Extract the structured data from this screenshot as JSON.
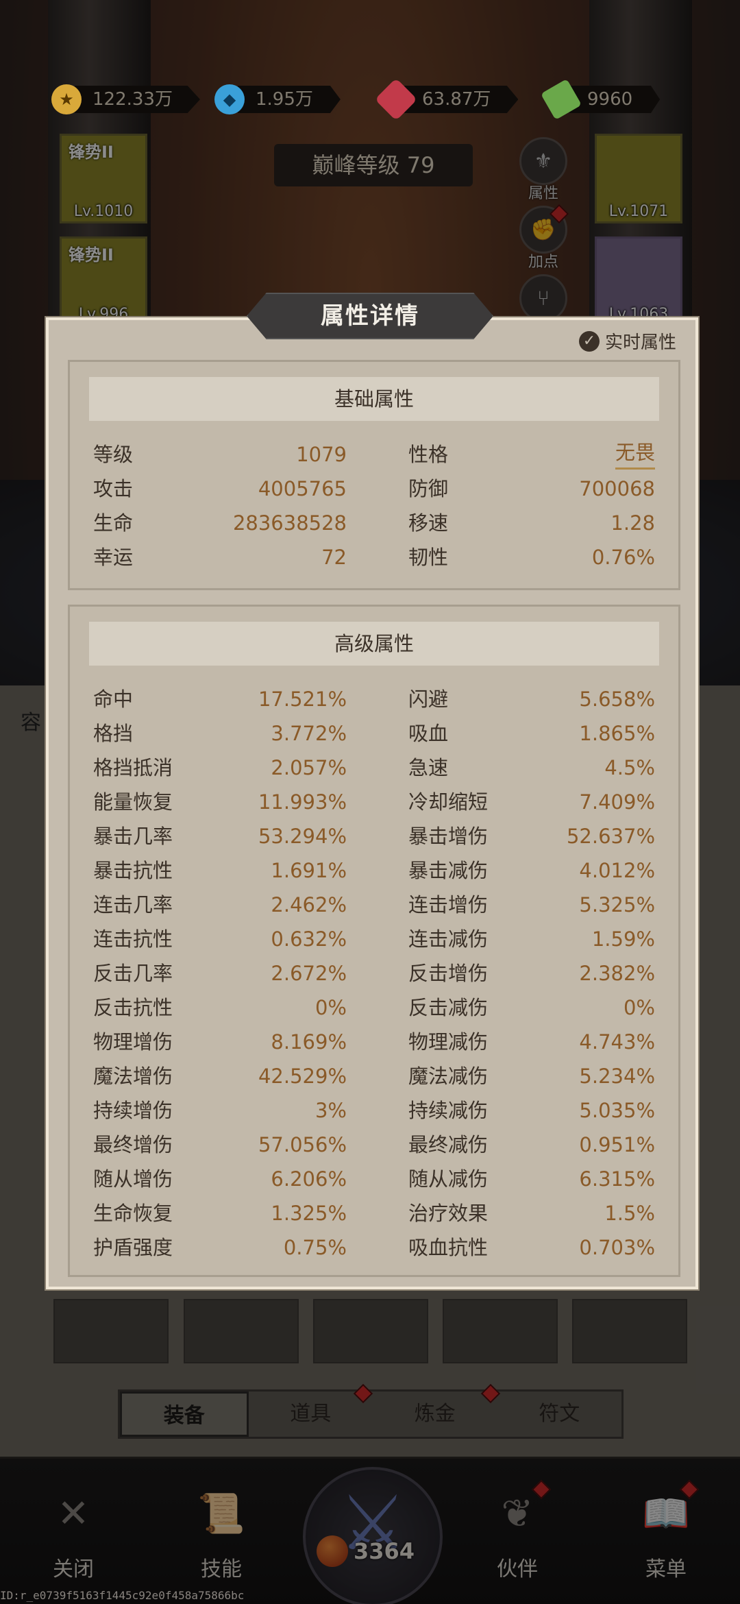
{
  "currencies": [
    {
      "name": "gold-coin-icon",
      "value": "122.33万"
    },
    {
      "name": "blue-gem-icon",
      "value": "1.95万"
    },
    {
      "name": "ruby-icon",
      "value": "63.87万"
    },
    {
      "name": "cash-icon",
      "value": "9960"
    }
  ],
  "peak_level": "巅峰等级 79",
  "cards": [
    {
      "name": "锋势II",
      "level": "Lv.1010"
    },
    {
      "name": "锋势II",
      "level": "Lv.996"
    },
    {
      "name": "",
      "level": "Lv.1071"
    },
    {
      "name": "",
      "level": "Lv.1063"
    }
  ],
  "side_buttons": {
    "attributes": "属性",
    "add_points": "加点"
  },
  "side_tab_partial": "容",
  "panel": {
    "title": "属性详情",
    "realtime_label": "实时属性",
    "basic": {
      "title": "基础属性",
      "rows": [
        [
          "等级",
          "1079",
          "性格",
          "无畏"
        ],
        [
          "攻击",
          "4005765",
          "防御",
          "700068"
        ],
        [
          "生命",
          "283638528",
          "移速",
          "1.28"
        ],
        [
          "幸运",
          "72",
          "韧性",
          "0.76%"
        ]
      ]
    },
    "advanced": {
      "title": "高级属性",
      "rows": [
        [
          "命中",
          "17.521%",
          "闪避",
          "5.658%"
        ],
        [
          "格挡",
          "3.772%",
          "吸血",
          "1.865%"
        ],
        [
          "格挡抵消",
          "2.057%",
          "急速",
          "4.5%"
        ],
        [
          "能量恢复",
          "11.993%",
          "冷却缩短",
          "7.409%"
        ],
        [
          "暴击几率",
          "53.294%",
          "暴击增伤",
          "52.637%"
        ],
        [
          "暴击抗性",
          "1.691%",
          "暴击减伤",
          "4.012%"
        ],
        [
          "连击几率",
          "2.462%",
          "连击增伤",
          "5.325%"
        ],
        [
          "连击抗性",
          "0.632%",
          "连击减伤",
          "1.59%"
        ],
        [
          "反击几率",
          "2.672%",
          "反击增伤",
          "2.382%"
        ],
        [
          "反击抗性",
          "0%",
          "反击减伤",
          "0%"
        ],
        [
          "物理增伤",
          "8.169%",
          "物理减伤",
          "4.743%"
        ],
        [
          "魔法增伤",
          "42.529%",
          "魔法减伤",
          "5.234%"
        ],
        [
          "持续增伤",
          "3%",
          "持续减伤",
          "5.035%"
        ],
        [
          "最终增伤",
          "57.056%",
          "最终减伤",
          "0.951%"
        ],
        [
          "随从增伤",
          "6.206%",
          "随从减伤",
          "6.315%"
        ],
        [
          "生命恢复",
          "1.325%",
          "治疗效果",
          "1.5%"
        ],
        [
          "护盾强度",
          "0.75%",
          "吸血抗性",
          "0.703%"
        ]
      ]
    }
  },
  "tabs": [
    "装备",
    "道具",
    "炼金",
    "符文"
  ],
  "nav": {
    "close": "关闭",
    "skills": "技能",
    "battle_count": "3364",
    "partner": "伙伴",
    "menu": "菜单"
  },
  "id_text": "ID:r_e0739f5163f1445c92e0f458a75866bc"
}
